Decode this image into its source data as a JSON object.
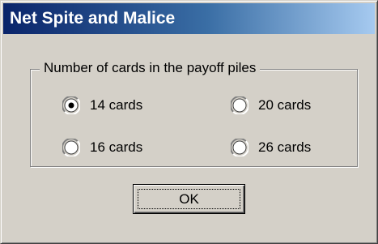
{
  "window": {
    "title": "Net Spite and Malice"
  },
  "group": {
    "label": "Number of cards in the payoff piles",
    "options": [
      {
        "label": "14 cards",
        "selected": true
      },
      {
        "label": "16 cards",
        "selected": false
      },
      {
        "label": "20 cards",
        "selected": false
      },
      {
        "label": "26 cards",
        "selected": false
      }
    ]
  },
  "buttons": {
    "ok_label": "OK"
  },
  "colors": {
    "title_start": "#0a246a",
    "title_end": "#a6caf0",
    "face": "#d4d0c8"
  }
}
